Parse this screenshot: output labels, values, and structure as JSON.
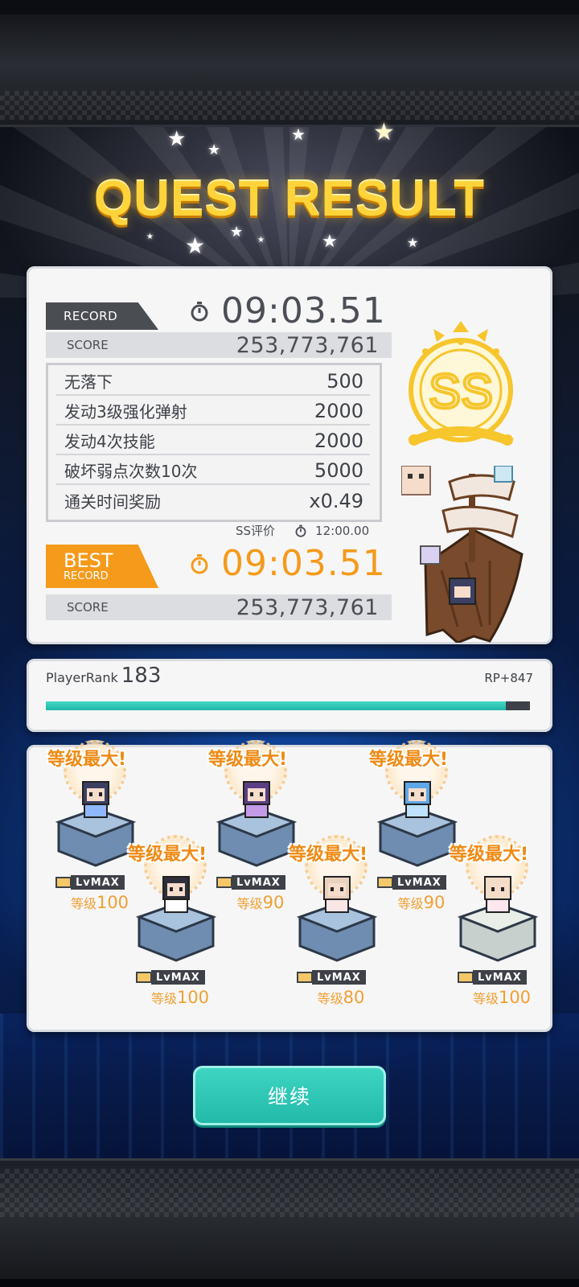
{
  "title": "QUEST RESULT",
  "record": {
    "tag": "RECORD",
    "time": "09:03.51",
    "score_label": "SCORE",
    "score": "253,773,761"
  },
  "bonuses": [
    {
      "label": "无落下",
      "value": "500"
    },
    {
      "label": "发动3级强化弹射",
      "value": "2000"
    },
    {
      "label": "发动4次技能",
      "value": "2000"
    },
    {
      "label": "破坏弱点次数10次",
      "value": "5000"
    },
    {
      "label": "通关时间奖励",
      "value": "x0.49"
    }
  ],
  "ss_requirement": {
    "label": "SS评价",
    "time": "12:00.00"
  },
  "best": {
    "tag_big": "BEST",
    "tag_small": "RECORD",
    "time": "09:03.51",
    "score_label": "SCORE",
    "score": "253,773,761"
  },
  "rank_badge": "SS",
  "player": {
    "rank_label": "PlayerRank",
    "rank": "183",
    "rp": "RP+847",
    "progress": 0.95
  },
  "characters": [
    {
      "max_label": "等级最大!",
      "lvmax": "LvMAX",
      "level_prefix": "等级",
      "level": "100",
      "hair": "#3c4060",
      "outfit": "#8fb7ff"
    },
    {
      "max_label": "等级最大!",
      "lvmax": "LvMAX",
      "level_prefix": "等级",
      "level": "100",
      "hair": "#2e2f3a",
      "outfit": "#ffffff"
    },
    {
      "max_label": "等级最大!",
      "lvmax": "LvMAX",
      "level_prefix": "等级",
      "level": "90",
      "hair": "#5b3f84",
      "outfit": "#c49be6"
    },
    {
      "max_label": "等级最大!",
      "lvmax": "LvMAX",
      "level_prefix": "等级",
      "level": "80",
      "hair": "#e9d2bd",
      "outfit": "#fbe6e6"
    },
    {
      "max_label": "等级最大!",
      "lvmax": "LvMAX",
      "level_prefix": "等级",
      "level": "90",
      "hair": "#5fa8e8",
      "outfit": "#bfe2ff"
    },
    {
      "max_label": "等级最大!",
      "lvmax": "LvMAX",
      "level_prefix": "等级",
      "level": "100",
      "hair": "#f2dcc6",
      "outfit": "#ffe7ef"
    }
  ],
  "continue_label": "继续",
  "colors": {
    "accent_gold": "#ffd33a",
    "best_orange": "#f59a1a",
    "teal": "#2cc7b6",
    "level_orange": "#ef8a14"
  }
}
